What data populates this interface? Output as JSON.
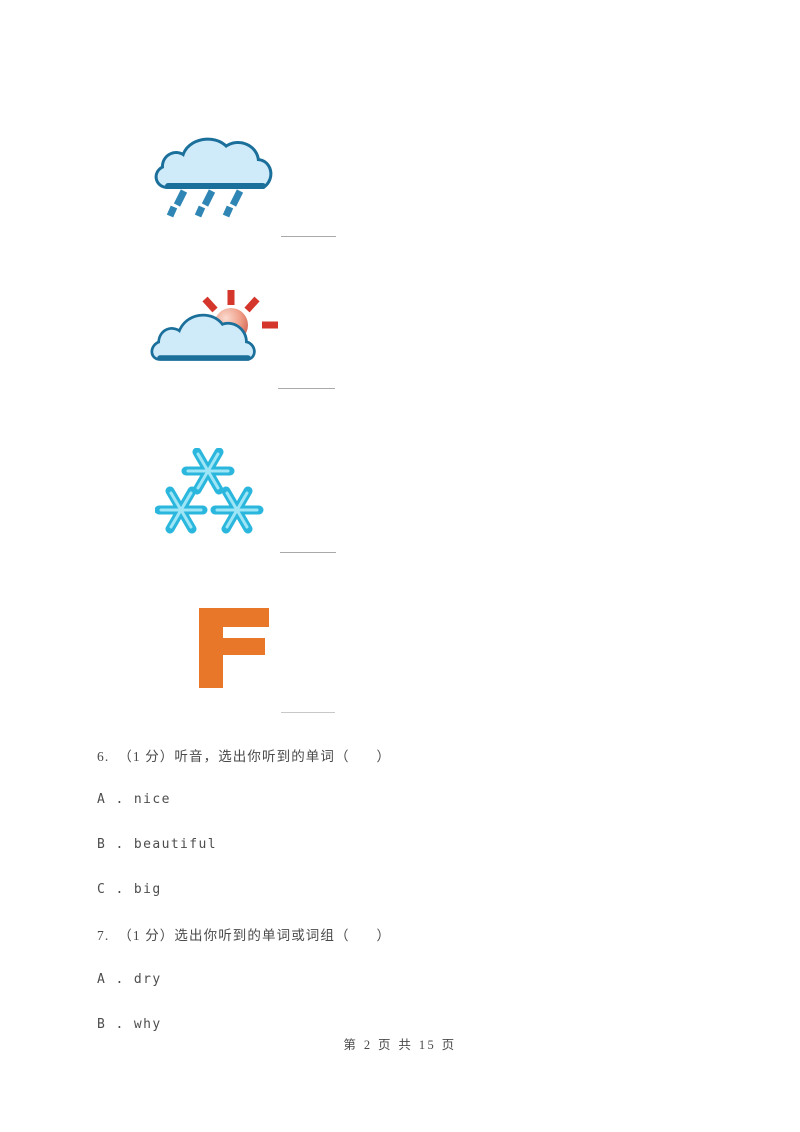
{
  "document": {
    "type": "english-exam-worksheet",
    "page_background": "#ffffff",
    "footer_text": "第 2 页 共 15 页",
    "footer_page_number": "2",
    "footer_total_pages": "15"
  },
  "colors": {
    "cloud_outline": "#1b6f9b",
    "cloud_fill": "#bfe5f7",
    "cloud_fill_light": "#d9f0fb",
    "rain_streak": "#2f86b4",
    "sun_ray": "#d5362b",
    "sun_body_light": "#f6c6b6",
    "sun_body_dark": "#d4604f",
    "snowflake": "#2bb7dd",
    "snowflake_core": "#8fe2f4",
    "letter_orange": "#e8772a",
    "answer_line": "#9a9a9a",
    "text": "#4a4a4a"
  },
  "picture_questions": [
    {
      "id": "pic-1",
      "icon": "rain-cloud-icon",
      "icon_label": "rainy weather",
      "answer_line_value": ""
    },
    {
      "id": "pic-2",
      "icon": "sun-behind-cloud-icon",
      "icon_label": "cloudy with sun",
      "answer_line_value": ""
    },
    {
      "id": "pic-3",
      "icon": "snowflakes-icon",
      "icon_label": "snowy weather",
      "answer_line_value": ""
    },
    {
      "id": "pic-4",
      "icon": "letter-f-icon",
      "icon_label": "letter F",
      "answer_line_value": ""
    }
  ],
  "text_questions": [
    {
      "id": "q6",
      "number": "6.",
      "stem": "6.  （1 分）听音，选出你听到的单词（      ）",
      "options": [
        {
          "key": "A",
          "text": "A . nice"
        },
        {
          "key": "B",
          "text": "B . beautiful"
        },
        {
          "key": "C",
          "text": "C . big"
        }
      ]
    },
    {
      "id": "q7",
      "number": "7.",
      "stem": "7.  （1 分）选出你听到的单词或词组（      ）",
      "options": [
        {
          "key": "A",
          "text": "A . dry"
        },
        {
          "key": "B",
          "text": "B . why"
        }
      ]
    }
  ]
}
